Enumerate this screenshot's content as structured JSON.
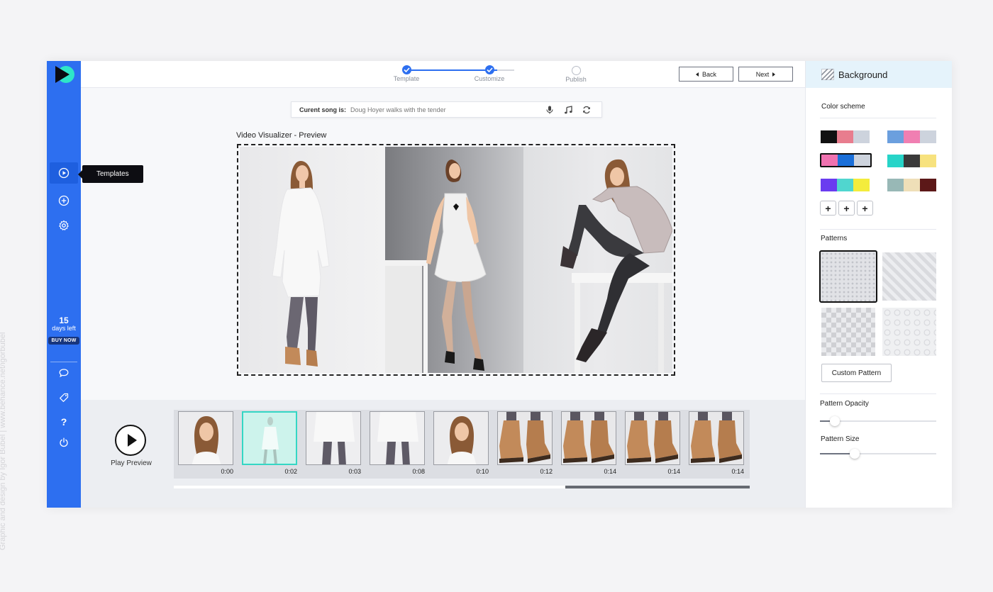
{
  "watermark": "Graphic and design by Igor Bubel | www.behance.net/igorbubel",
  "sidebar": {
    "nav": [
      {
        "name": "templates",
        "icon": "play-circle-icon",
        "active": true
      },
      {
        "name": "add",
        "icon": "plus-circle-icon",
        "active": false
      },
      {
        "name": "settings",
        "icon": "gear-icon",
        "active": false
      }
    ],
    "trial": {
      "days": "15",
      "days_label": "days left",
      "buy_label": "BUY NOW"
    },
    "bottom": [
      {
        "name": "chat",
        "icon": "chat-bubble-icon"
      },
      {
        "name": "tag",
        "icon": "tag-icon"
      },
      {
        "name": "help",
        "icon": "question-mark-icon",
        "glyph": "?"
      },
      {
        "name": "power",
        "icon": "power-icon"
      }
    ],
    "tooltip": "Templates"
  },
  "stepper": {
    "steps": [
      {
        "label": "Template",
        "done": true
      },
      {
        "label": "Customize",
        "done": true
      },
      {
        "label": "Publish",
        "done": false
      }
    ]
  },
  "topbar": {
    "back_label": "Back",
    "next_label": "Next"
  },
  "song": {
    "label": "Curent song is:",
    "value": "Doug Hoyer walks with the tender",
    "icons": [
      "microphone-icon",
      "music-note-icon",
      "refresh-icon"
    ]
  },
  "preview": {
    "title": "Video Visualizer - Preview"
  },
  "timeline": {
    "play_label": "Play Preview",
    "thumbs": [
      {
        "time": "0:00",
        "kind": "portrait",
        "selected": false
      },
      {
        "time": "0:02",
        "kind": "figure",
        "selected": true
      },
      {
        "time": "0:03",
        "kind": "legs",
        "selected": false
      },
      {
        "time": "0:08",
        "kind": "legs",
        "selected": false
      },
      {
        "time": "0:10",
        "kind": "portrait",
        "selected": false
      },
      {
        "time": "0:12",
        "kind": "boots",
        "selected": false
      },
      {
        "time": "0:14",
        "kind": "boots",
        "selected": false
      },
      {
        "time": "0:14",
        "kind": "boots",
        "selected": false
      },
      {
        "time": "0:14",
        "kind": "boots",
        "selected": false
      }
    ],
    "scroll_position": 0.68
  },
  "panel": {
    "title": "Background",
    "title_icon": "stripes-icon",
    "color_scheme_label": "Color scheme",
    "swatches": [
      {
        "colors": [
          "#111111",
          "#e87d8e",
          "#cdd3dd"
        ],
        "selected": false
      },
      {
        "colors": [
          "#6b9fde",
          "#f07fb2",
          "#cdd3dd"
        ],
        "selected": false
      },
      {
        "colors": [
          "#ef72b0",
          "#1a6fd9",
          "#cdd3dd"
        ],
        "selected": true
      },
      {
        "colors": [
          "#27d4c8",
          "#3a3a3a",
          "#f7e27e"
        ],
        "selected": false
      },
      {
        "colors": [
          "#6a3cf0",
          "#50d6cf",
          "#f4ec3c"
        ],
        "selected": false
      },
      {
        "colors": [
          "#98b8b6",
          "#efdfb8",
          "#5c1818"
        ],
        "selected": false
      }
    ],
    "add_buttons": [
      "+",
      "+",
      "+"
    ],
    "patterns_label": "Patterns",
    "patterns": [
      {
        "name": "dots",
        "selected": true
      },
      {
        "name": "stripes",
        "selected": false
      },
      {
        "name": "diamonds",
        "selected": false
      },
      {
        "name": "circles",
        "selected": false
      }
    ],
    "custom_pattern_label": "Custom Pattern",
    "opacity_label": "Pattern Opacity",
    "opacity_value": 0.13,
    "size_label": "Pattern Size",
    "size_value": 0.3
  }
}
